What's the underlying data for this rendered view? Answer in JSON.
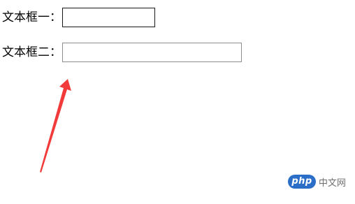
{
  "form": {
    "field1": {
      "label": "文本框一：",
      "value": "",
      "placeholder": ""
    },
    "field2": {
      "label": "文本框二：",
      "value": "",
      "placeholder": ""
    }
  },
  "annotation": {
    "arrow_color": "#f23a3a"
  },
  "watermark": {
    "logo": "php",
    "text": "中文网",
    "logo_color": "#2a6ec8"
  }
}
